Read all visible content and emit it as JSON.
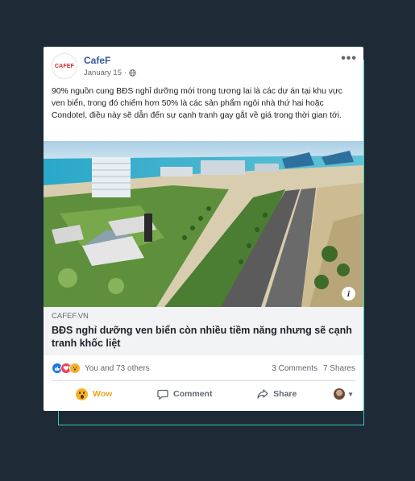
{
  "post": {
    "page_name": "CafeF",
    "page_logo_text": "CAFEF",
    "date": "January 15",
    "separator": "·",
    "text": "90% nguồn cung BĐS nghỉ dưỡng mới trong tương lai là các dự án tại khu vực ven biển, trong đó chiếm hơn 50% là các sản phẩm ngôi nhà thứ hai hoặc Condotel, điều này sẽ dẫn đến sự cạnh tranh gay gắt về giá trong thời gian tới.",
    "more_label": "•••"
  },
  "link": {
    "domain": "CAFEF.VN",
    "title": "BĐS nghỉ dưỡng ven biển còn nhiều tiềm năng nhưng sẽ cạnh tranh khốc liệt",
    "info_label": "i"
  },
  "stats": {
    "reactions_text": "You and 73 others",
    "comments": "3 Comments",
    "shares": "7 Shares"
  },
  "actions": {
    "reaction_label": "Wow",
    "comment_label": "Comment",
    "share_label": "Share"
  },
  "colors": {
    "background": "#1e2a35",
    "frame_accent": "#3ec7b8",
    "page_name": "#365899",
    "wow": "#e9a620"
  },
  "icons": [
    "globe-icon",
    "more-options-icon",
    "info-icon",
    "like-icon",
    "love-icon",
    "wow-icon",
    "comment-icon",
    "share-icon",
    "chevron-down-icon"
  ]
}
